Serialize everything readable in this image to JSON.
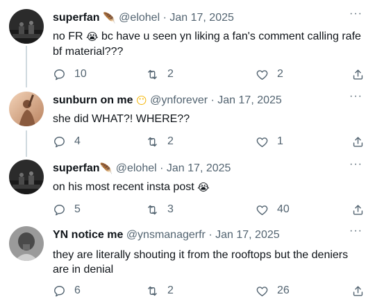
{
  "tweets": [
    {
      "name": "superfan",
      "name_emoji": "🪶",
      "handle": "@elohel",
      "separator": "·",
      "date": "Jan 17, 2025",
      "text_before": "no FR ",
      "text_emoji": "😭",
      "text_after": " bc have u seen yn liking a fan's comment calling rafe bf material???",
      "replies": "10",
      "retweets": "2",
      "likes": "2"
    },
    {
      "name": "sunburn on me",
      "name_emoji": "😶",
      "handle": "@ynforever",
      "separator": "·",
      "date": "Jan 17, 2025",
      "text": "she did WHAT?! WHERE??",
      "replies": "4",
      "retweets": "2",
      "likes": "1"
    },
    {
      "name": "superfan",
      "name_emoji": "🪶",
      "handle": "@elohel",
      "separator": "·",
      "date": "Jan 17, 2025",
      "text_before": "on his most recent insta post ",
      "text_emoji": "😭",
      "replies": "5",
      "retweets": "3",
      "likes": "40"
    },
    {
      "name": "YN notice me",
      "handle": "@ynsmanagerfr",
      "separator": "·",
      "date": "Jan 17, 2025",
      "text": "they are literally shouting it from the rooftops but the deniers are in denial",
      "replies": "6",
      "retweets": "2",
      "likes": "26"
    }
  ],
  "more_label": "···",
  "colors": {
    "text": "#0f1419",
    "secondary": "#536471",
    "thread": "#cfd9de",
    "plume": "#e0245e"
  },
  "icons": [
    "reply-icon",
    "retweet-icon",
    "like-icon",
    "share-icon",
    "more-icon"
  ]
}
